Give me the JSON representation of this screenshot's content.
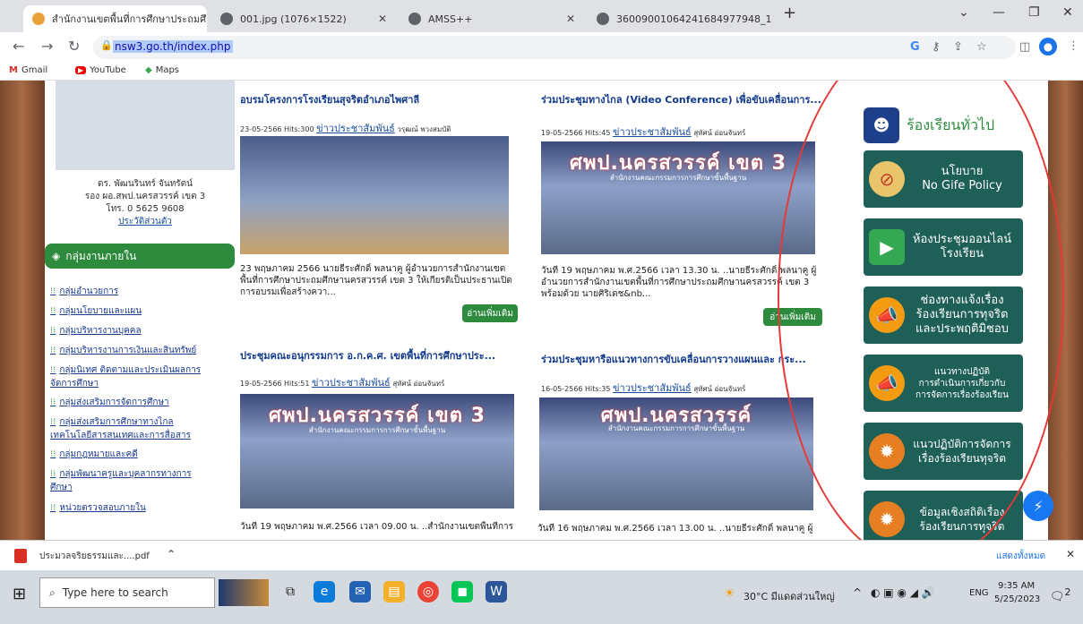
{
  "browser": {
    "tabs": [
      {
        "label": "สำนักงานเขตพื้นที่การศึกษาประถมศึ",
        "active": true
      },
      {
        "label": "001.jpg (1076×1522)",
        "active": false
      },
      {
        "label": "AMSS++",
        "active": false
      },
      {
        "label": "3600900106424168497794​8_1.p",
        "active": false
      }
    ],
    "new_tab": "+",
    "url": "nsw3.go.th/index.php",
    "bookmarks": [
      {
        "icon": "M",
        "label": "Gmail"
      },
      {
        "icon": "▶",
        "label": "YouTube"
      },
      {
        "icon": "◆",
        "label": "Maps"
      }
    ]
  },
  "sidebar": {
    "name": "ดร. พัฒนรินทร์ จันทรัตน์",
    "position": "รอง ผอ.สพป.นครสวรรค์ เขต 3",
    "phone": "โทร. 0 5625 9608",
    "history_link": "ประวัติส่วนตัว",
    "group_title": "กลุ่มงานภายใน",
    "groups": [
      "กลุ่มอำนวยการ",
      "กลุ่มนโยบายและแผน",
      "กลุ่มบริหารงานบุคคล",
      "กลุ่มบริหารงานการเงินและสินทรัพย์",
      "กลุ่มนิเทศ ติดตามและประเมินผลการจัดการศึกษา",
      "กลุ่มส่งเสริมการจัดการศึกษา",
      "กลุ่มส่งเสริมการศึกษาทางไกล เทคโนโลยีสารสนเทศและการสื่อสาร",
      "กลุ่มกฎหมายและคดี",
      "กลุ่มพัฒนาครูและบุคลากรทางการศึกษา",
      "หน่วยตรวจสอบภายใน"
    ]
  },
  "news": [
    {
      "title": "อบรมโครงการโรงเรียนสุจริตอำเภอไพศาลี",
      "date_hits": "23-05-2566 Hits:300",
      "category": "ข่าวประชาสัมพันธ์",
      "author": "วรุฒณ์ พวงสมบัติ",
      "desc": "23 พฤษภาคม 2566 นายธีระศักดิ์ พลนาคู ผู้อำนวยการสำนักงานเขตพื้นที่การศึกษาประถมศึกษานครสวรรค์ เขต 3 ให้เกียรติเป็นประธานเปิดการอบรมเพื่อสร้างควา..."
    },
    {
      "title": "ร่วมประชุมทางไกล (Video Conference) เพื่อขับเคลื่อนการ...",
      "date_hits": "19-05-2566 Hits:45",
      "category": "ข่าวประชาสัมพันธ์",
      "author": "สุทัศน์ อ่อนจันทร์",
      "banner": "ศพป.นครสวรรค์ เขต 3",
      "banner_sub": "สำนักงานคณะกรรมการการศึกษาขั้นพื้นฐาน",
      "desc": "วันที่ 19 พฤษภาคม พ.ศ.2566 เวลา 13.30 น. ..นายธีระศักดิ์ พลนาคู ผู้อำนวยการสำนักงานเขตพื้นที่การศึกษาประถมศึกษานครสวรรค์ เขต 3 พร้อมด้วย นายศิริเดช&nb..."
    },
    {
      "title": "ประชุมคณะอนุกรรมการ อ.ก.ค.ศ. เขตพื้นที่การศึกษาประ...",
      "date_hits": "19-05-2566 Hits:51",
      "category": "ข่าวประชาสัมพันธ์",
      "author": "สุทัศน์ อ่อนจันทร์",
      "banner": "ศพป.นครสวรรค์ เขต 3",
      "banner_sub": "สำนักงานคณะกรรมการการศึกษาขั้นพื้นฐาน",
      "desc": "วันที่ 19 พฤษภาคม พ.ศ.2566 เวลา 09.00 น. ..สำนักงานเขตพื้นที่การ"
    },
    {
      "title": "ร่วมประชุมหารือแนวทางการขับเคลื่อนการวางแผนและ กระ...",
      "date_hits": "16-05-2566 Hits:35",
      "category": "ข่าวประชาสัมพันธ์",
      "author": "สุทัศน์ อ่อนจันทร์",
      "banner": "ศพป.นครสวรรค์",
      "banner_sub": "สำนักงานคณะกรรมการการศึกษาขั้นพื้นฐาน",
      "desc": "วันที่ 16 พฤษภาคม พ.ศ.2566 เวลา 13.00 น. ..นายธีระศักดิ์ พลนาคู ผู้"
    }
  ],
  "read_more": "อ่านเพิ่มเติม",
  "right_links": {
    "complaint": "ร้องเรียนทั่วไป",
    "items": [
      {
        "l1": "นโยบาย",
        "l2": "No Gife Policy",
        "l3": ""
      },
      {
        "l1": "ห้องประชุมออนไลน์",
        "l2": "โรงเรียน",
        "l3": ""
      },
      {
        "l1": "ช่องทางแจ้งเรื่อง",
        "l2": "ร้องเรียนการทุจริต",
        "l3": "และประพฤติมิชอบ"
      },
      {
        "l1": "แนวทางปฏิบัติ",
        "l2": "การดำเนินการเกี่ยวกับ",
        "l3": "การจัดการเรื่องร้องเรียน"
      },
      {
        "l1": "แนวปฏิบัติการจัดการ",
        "l2": "เรื่องร้องเรียนทุจริต",
        "l3": ""
      },
      {
        "l1": "ข้อมูลเชิงสถิติเรื่อง",
        "l2": "ร้องเรียนการทุจริต",
        "l3": ""
      }
    ]
  },
  "download": {
    "file": "ประมวลจริยธรรมและ....pdf",
    "show_all": "แสดงทั้งหมด"
  },
  "taskbar": {
    "search_placeholder": "Type here to search",
    "weather": "30°C มีแดดส่วนใหญ่",
    "lang": "ENG",
    "time": "9:35 AM",
    "date": "5/25/2023",
    "notifications": "2"
  },
  "colors": {
    "green": "#2e8b3e",
    "teal": "#1e5f58",
    "link": "#1a4d9e",
    "annotation": "#e53935"
  }
}
